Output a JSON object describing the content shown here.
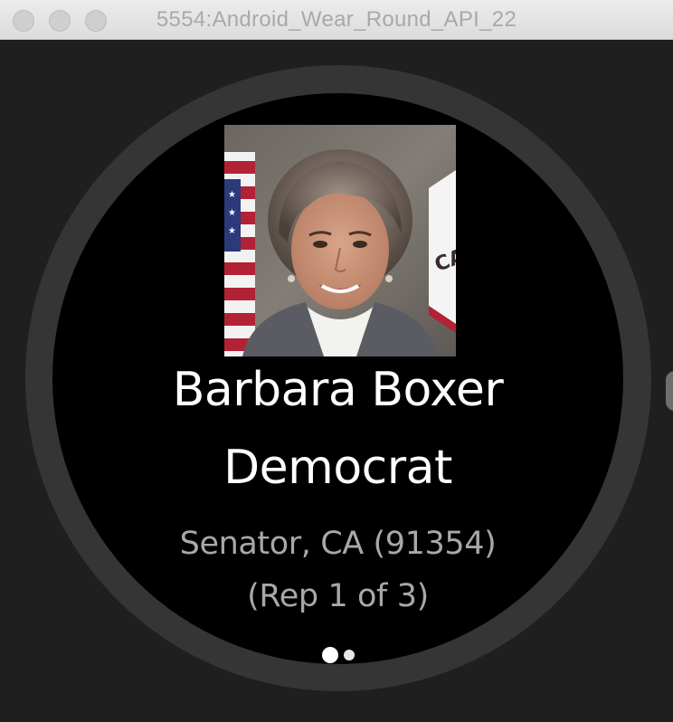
{
  "window": {
    "title": "5554:Android_Wear_Round_API_22"
  },
  "card": {
    "photo_icon": "portrait-photo",
    "name": "Barbara Boxer",
    "party": "Democrat",
    "office": "Senator, CA (91354)",
    "index": "(Rep 1 of 3)"
  },
  "pager": {
    "current": 1,
    "total": 2
  },
  "colors": {
    "background": "#1f1f1f",
    "bezel": "#353535",
    "face": "#000000",
    "primary_text": "#ffffff",
    "secondary_text": "#a8a8a8"
  }
}
